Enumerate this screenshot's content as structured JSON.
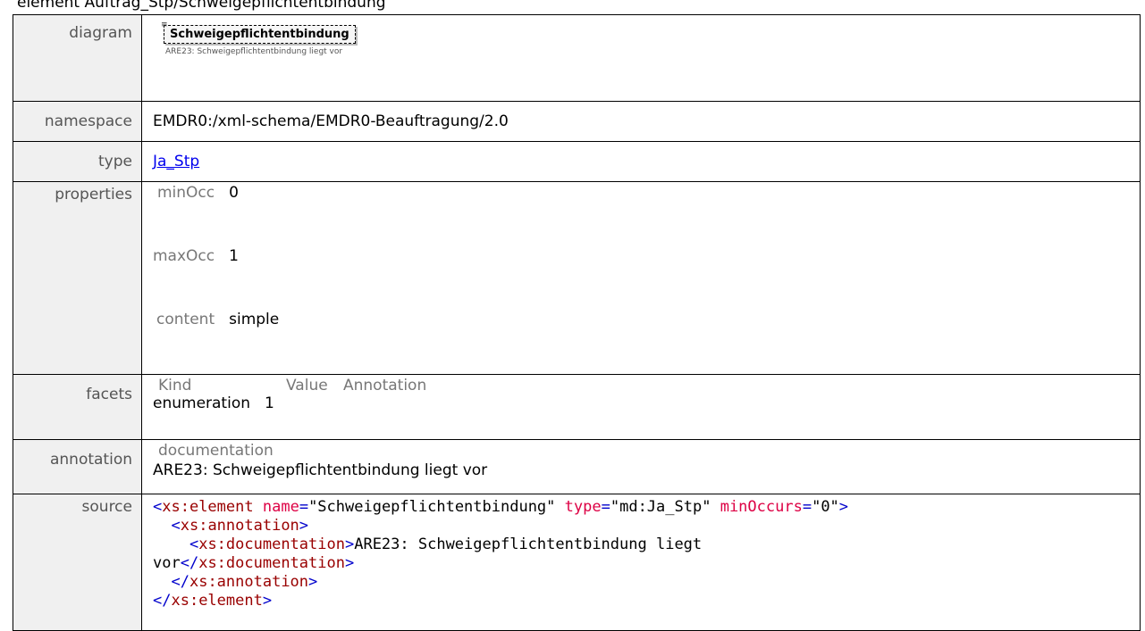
{
  "heading": "element Auftrag_Stp/Schweigepflichtentbindung",
  "labels": {
    "diagram": "diagram",
    "namespace": "namespace",
    "type": "type",
    "properties": "properties",
    "facets": "facets",
    "annotation": "annotation",
    "source": "source"
  },
  "diagram": {
    "element_name": "Schweigepflichtentbindung",
    "doc_text": "ARE23: Schweigepflichtentbindung liegt vor"
  },
  "namespace": "EMDR0:/xml-schema/EMDR0-Beauftragung/2.0",
  "type_link": "Ja_Stp",
  "properties": [
    {
      "key": "minOcc",
      "value": "0"
    },
    {
      "key": "maxOcc",
      "value": "1"
    },
    {
      "key": "content",
      "value": "simple"
    }
  ],
  "facets": {
    "headers": [
      "Kind",
      "Value",
      "Annotation"
    ],
    "rows": [
      {
        "kind": "enumeration",
        "value": "1",
        "annotation": ""
      }
    ]
  },
  "annotation": {
    "header": "documentation",
    "text": "ARE23: Schweigepflichtentbindung liegt vor"
  },
  "source": {
    "line1_open": "<",
    "line1_tag": "xs:element",
    "line1_a1": "name",
    "line1_v1": "\"Schweigepflichtentbindung\"",
    "line1_a2": "type",
    "line1_v2": "\"md:Ja_Stp\"",
    "line1_a3": "minOccurs",
    "line1_v3": "\"0\"",
    "line1_close": ">",
    "line2_tag": "xs:annotation",
    "line3_tag": "xs:documentation",
    "line3_text": "ARE23: Schweigepflichtentbindung liegt",
    "line4_text": "vor",
    "line4_tag": "xs:documentation",
    "line5_tag": "xs:annotation",
    "line6_tag": "xs:element"
  }
}
